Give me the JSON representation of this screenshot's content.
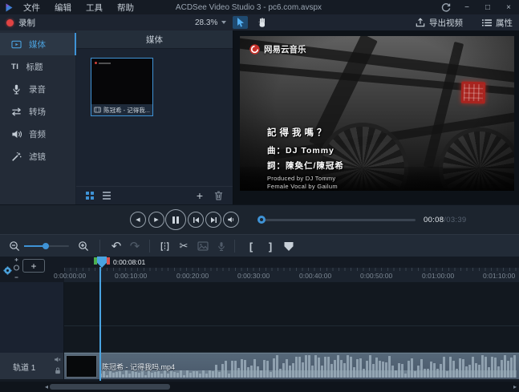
{
  "window": {
    "title": "ACDSee Video Studio 3 - pc6.com.avspx",
    "menus": [
      "文件",
      "编辑",
      "工具",
      "帮助"
    ]
  },
  "toolbar": {
    "record": "录制",
    "zoom_level": "28.3%",
    "export": "导出视频",
    "properties": "属性"
  },
  "sidebar": {
    "items": [
      {
        "label": "媒体",
        "selected": true
      },
      {
        "label": "标题",
        "selected": false
      },
      {
        "label": "录音",
        "selected": false
      },
      {
        "label": "转场",
        "selected": false
      },
      {
        "label": "音频",
        "selected": false
      },
      {
        "label": "滤镜",
        "selected": false
      }
    ]
  },
  "media_panel": {
    "header": "媒体",
    "clip_name": "陈冠希 - 记得我..."
  },
  "preview": {
    "watermark": "网易云音乐",
    "lyrics": [
      "記得我嗎？",
      "曲：DJ Tommy",
      "詞：陳奐仁/陳冠希",
      "Produced by DJ Tommy",
      "Female Vocal by Gailum"
    ]
  },
  "transport": {
    "time_current": "00:08",
    "time_separator": "/",
    "time_total": "03:39"
  },
  "timeline": {
    "playhead_time": "0:00:08:01",
    "ruler_ticks": [
      "0:00:00:00",
      "0:00:10:00",
      "0:00:20:00",
      "0:00:30:00",
      "0:00:40:00",
      "0:00:50:00",
      "0:01:00:00",
      "0:01:10:00"
    ],
    "track_label": "轨道 1",
    "clip_label": "陈冠希 - 记得我吗.mp4"
  },
  "colors": {
    "accent": "#3f93d6",
    "record_red": "#e04343",
    "playhead_green": "#4caf50",
    "playhead_red": "#d9534f"
  }
}
